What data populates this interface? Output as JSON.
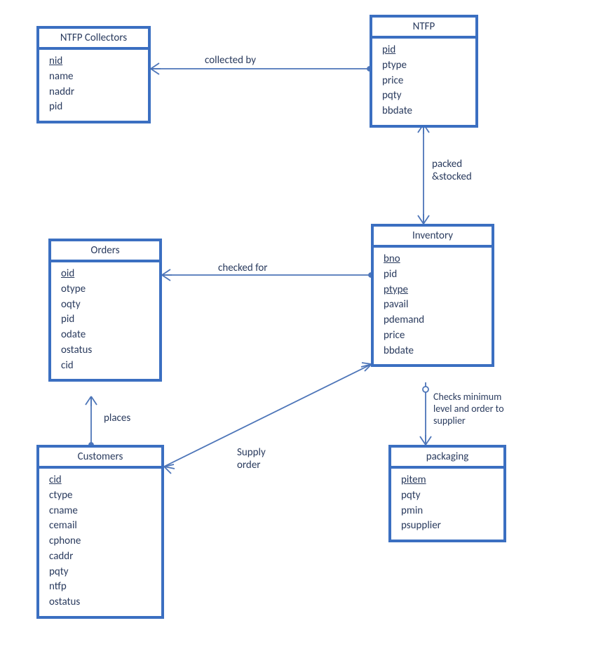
{
  "entities": {
    "ntfp_collectors": {
      "title": "NTFP Collectors",
      "attrs": [
        {
          "name": "nid",
          "key": true
        },
        {
          "name": "name"
        },
        {
          "name": "naddr"
        },
        {
          "name": "pid"
        }
      ]
    },
    "ntfp": {
      "title": "NTFP",
      "attrs": [
        {
          "name": "pid",
          "key": true
        },
        {
          "name": "ptype"
        },
        {
          "name": "price"
        },
        {
          "name": "pqty"
        },
        {
          "name": "bbdate"
        }
      ]
    },
    "orders": {
      "title": "Orders",
      "attrs": [
        {
          "name": "oid",
          "key": true
        },
        {
          "name": "otype"
        },
        {
          "name": "oqty"
        },
        {
          "name": "pid"
        },
        {
          "name": "odate"
        },
        {
          "name": "ostatus"
        },
        {
          "name": "cid"
        }
      ]
    },
    "inventory": {
      "title": "Inventory",
      "attrs": [
        {
          "name": "bno",
          "key": true
        },
        {
          "name": "pid"
        },
        {
          "name": "ptype",
          "key": true
        },
        {
          "name": "pavail"
        },
        {
          "name": "pdemand"
        },
        {
          "name": "price"
        },
        {
          "name": "bbdate"
        }
      ]
    },
    "customers": {
      "title": "Customers",
      "attrs": [
        {
          "name": "cid",
          "key": true
        },
        {
          "name": "ctype"
        },
        {
          "name": "cname"
        },
        {
          "name": "cemail"
        },
        {
          "name": "cphone"
        },
        {
          "name": "caddr"
        },
        {
          "name": "pqty"
        },
        {
          "name": "ntfp"
        },
        {
          "name": "ostatus"
        }
      ]
    },
    "packaging": {
      "title": "packaging",
      "attrs": [
        {
          "name": "pitem",
          "key": true
        },
        {
          "name": "pqty"
        },
        {
          "name": "pmin"
        },
        {
          "name": "psupplier"
        }
      ]
    }
  },
  "relationships": {
    "collected_by": "collected by",
    "packed_stocked": "packed\n&stocked",
    "checked_for": "checked for",
    "places": "places",
    "supply_order": "Supply\norder",
    "checks_min": "Checks minimum\nlevel and order to\nsupplier"
  }
}
